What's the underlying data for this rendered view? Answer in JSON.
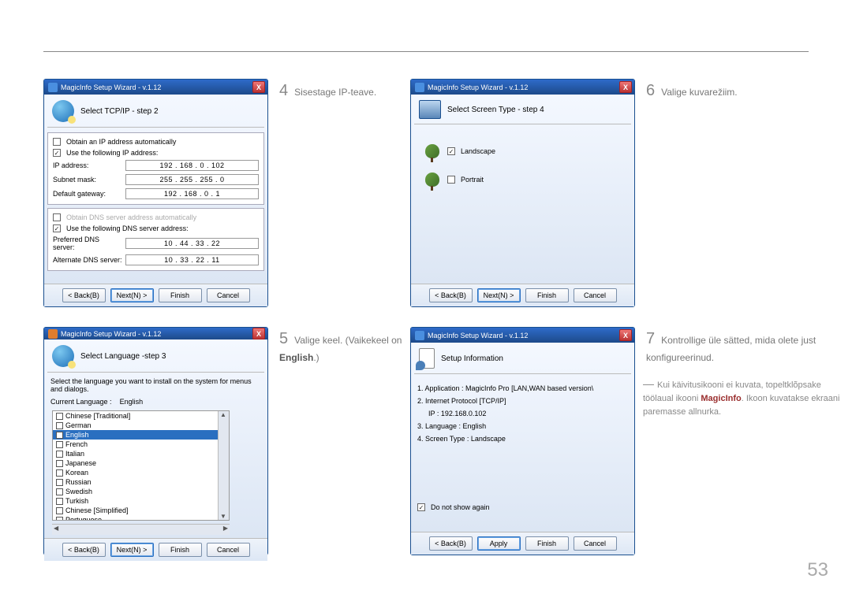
{
  "page_number": "53",
  "window_title": "MagicInfo Setup Wizard - v.1.12",
  "buttons": {
    "back": "< Back(B)",
    "next": "Next(N) >",
    "finish": "Finish",
    "cancel": "Cancel",
    "apply": "Apply"
  },
  "step4": {
    "num": "4",
    "caption": "Sisestage IP-teave.",
    "header": "Select TCP/IP - step 2",
    "obtain_auto": "Obtain an IP address automatically",
    "use_following": "Use the following IP address:",
    "rows": {
      "ip_label": "IP address:",
      "ip_value": "192 . 168 .  0  . 102",
      "subnet_label": "Subnet mask:",
      "subnet_value": "255 . 255 . 255 .  0",
      "gateway_label": "Default gateway:",
      "gateway_value": "192 . 168 .  0  .  1"
    },
    "obtain_dns_auto": "Obtain DNS server address automatically",
    "use_following_dns": "Use the following DNS server address:",
    "dns1_label": "Preferred DNS server:",
    "dns1_value": "10 . 44 . 33 . 22",
    "dns2_label": "Alternate DNS server:",
    "dns2_value": "10 . 33 . 22 . 11"
  },
  "step5": {
    "num": "5",
    "caption_a": "Valige keel. (Vaikekeel on ",
    "caption_b": "English",
    "caption_c": ".)",
    "header": "Select Language -step 3",
    "desc": "Select the language you want to install on the system for menus and dialogs.",
    "current_label": "Current Language    :",
    "current_value": "English",
    "languages": [
      "Chinese [Traditional]",
      "German",
      "English",
      "French",
      "Italian",
      "Japanese",
      "Korean",
      "Russian",
      "Swedish",
      "Turkish",
      "Chinese [Simplified]",
      "Portuguese"
    ],
    "selected_index": 2
  },
  "step6": {
    "num": "6",
    "caption": "Valige kuvarežiim.",
    "header": "Select Screen Type - step 4",
    "opt1": "Landscape",
    "opt2": "Portrait"
  },
  "step7": {
    "num": "7",
    "caption": "Kontrollige üle sätted, mida olete just konfigureerinud.",
    "header": "Setup Information",
    "rows": {
      "r1": "1. Application   :   MagicInfo Pro [LAN,WAN based version\\",
      "r2": "2. Internet Protocol [TCP/IP]",
      "r2b": "IP :      192.168.0.102",
      "r3": "3. Language   :   English",
      "r4": "4. Screen Type   :   Landscape"
    },
    "donotshow": "Do not show again",
    "note_a": "Kui käivitusikooni ei kuvata, topeltklõpsake töölaual ikooni ",
    "note_hl": "MagicInfo",
    "note_b": ". Ikoon kuvatakse ekraani paremasse allnurka."
  }
}
